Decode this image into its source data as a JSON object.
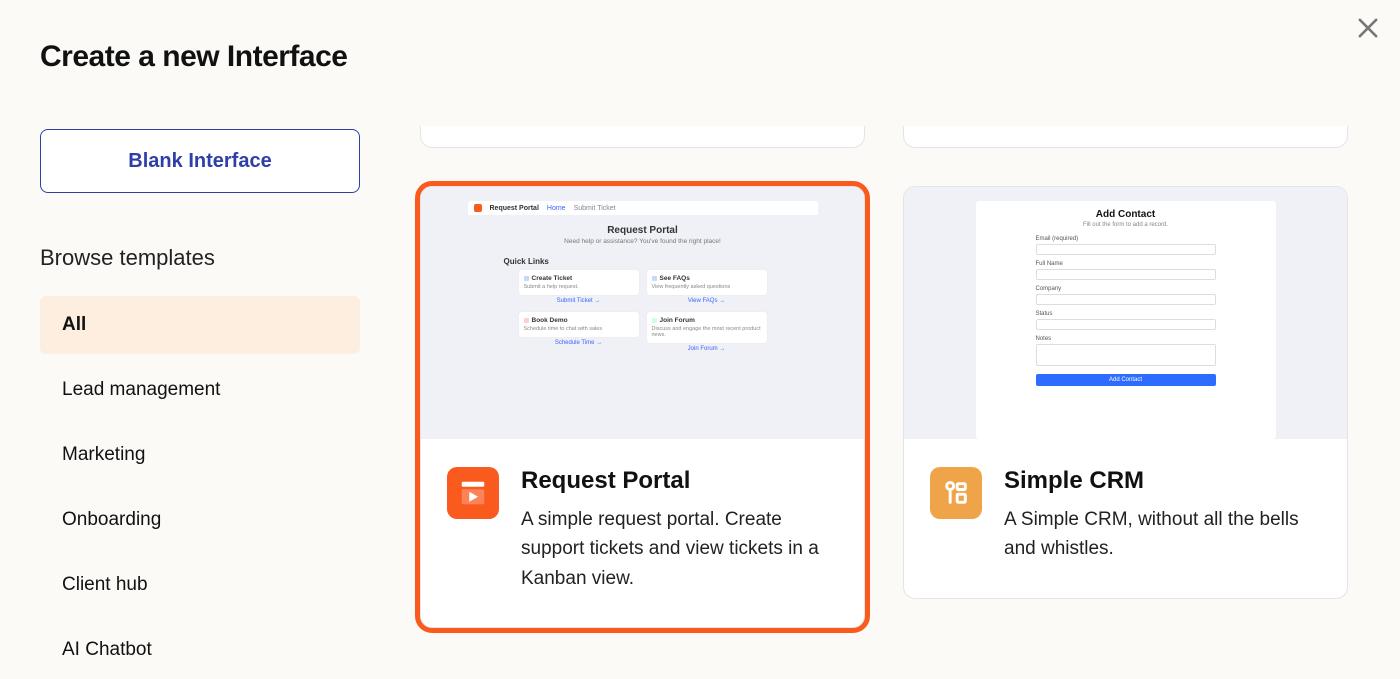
{
  "page": {
    "title": "Create a new Interface",
    "blank_button": "Blank Interface",
    "browse_heading": "Browse templates"
  },
  "categories": [
    {
      "label": "All",
      "active": true
    },
    {
      "label": "Lead management",
      "active": false
    },
    {
      "label": "Marketing",
      "active": false
    },
    {
      "label": "Onboarding",
      "active": false
    },
    {
      "label": "Client hub",
      "active": false
    },
    {
      "label": "AI Chatbot",
      "active": false
    }
  ],
  "templates": {
    "request_portal": {
      "title": "Request Portal",
      "description": "A simple request portal. Create support tickets and view tickets in a Kanban view.",
      "selected": true,
      "preview": {
        "app_name": "Request Portal",
        "nav_home": "Home",
        "nav_submit": "Submit Ticket",
        "hero_title": "Request Portal",
        "hero_sub": "Need help or assistance? You've found the right place!",
        "quick_links_heading": "Quick Links",
        "cards": [
          {
            "title": "Create Ticket",
            "desc": "Submit a help request.",
            "link": "Submit Ticket →"
          },
          {
            "title": "See FAQs",
            "desc": "View frequently asked questions",
            "link": "View FAQs →"
          },
          {
            "title": "Book Demo",
            "desc": "Schedule time to chat with sales",
            "link": "Schedule Time →"
          },
          {
            "title": "Join Forum",
            "desc": "Discuss and engage the most recent product news.",
            "link": "Join Forum →"
          }
        ]
      }
    },
    "simple_crm": {
      "title": "Simple CRM",
      "description": "A Simple CRM, without all the bells and whistles.",
      "selected": false,
      "preview": {
        "title": "Add Contact",
        "sub": "Fill out the form to add a record.",
        "fields": [
          "Email (required)",
          "Full Name",
          "Company",
          "Status",
          "Notes"
        ],
        "button": "Add Contact"
      }
    }
  }
}
